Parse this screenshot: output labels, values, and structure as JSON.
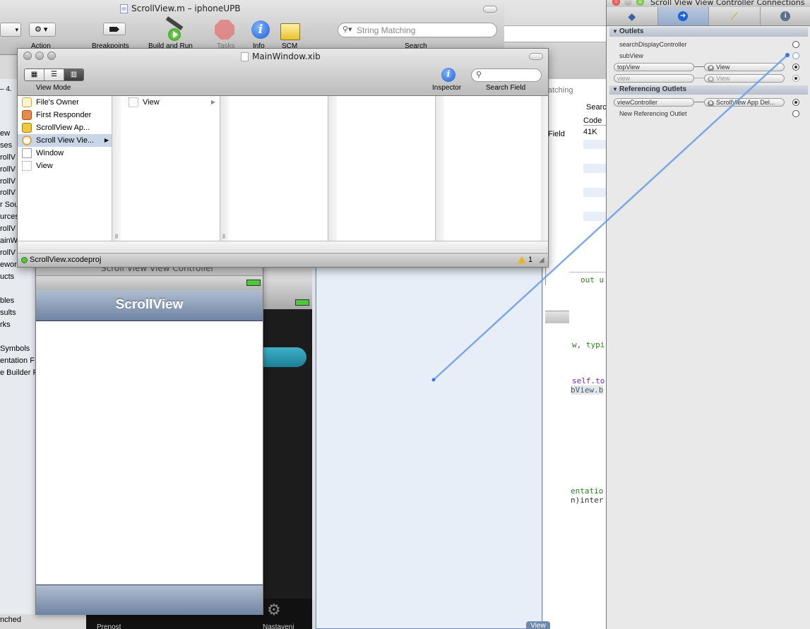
{
  "xcode_window": {
    "title": "ScrollView.m – iphoneUPB",
    "toolbar": [
      {
        "label": "Action"
      },
      {
        "label": "Breakpoints"
      },
      {
        "label": "Build and Run"
      },
      {
        "label": "Tasks"
      },
      {
        "label": "Info"
      },
      {
        "label": "SCM"
      },
      {
        "label": "Search"
      }
    ],
    "search_placeholder": "String Matching",
    "left_fragments": [
      "– 4.",
      "ew",
      "ses",
      "rollV",
      "rollV",
      "rollV",
      "rollV",
      "r Sou",
      "urces",
      "rollV",
      "ainW",
      "rollV",
      "ewor",
      "ucts",
      "bles",
      "sults",
      "rks",
      "Symbols",
      "entation F",
      "e Builder F"
    ],
    "status_fragment": "nched",
    "code_fragments": [
      "out u",
      "w, typi",
      "self.to",
      "bView.b",
      "entatio",
      "n)inter"
    ],
    "table_fragments": {
      "search_tab": "Searc",
      "column_code": "Code",
      "size_value": "41K",
      "field_label": "Field",
      "matching_label": "atching"
    }
  },
  "xib_window": {
    "title": "MainWindow.xib",
    "view_mode_label": "View Mode",
    "inspector_label": "Inspector",
    "search_field_label": "Search Field",
    "objects": [
      {
        "label": "File's Owner",
        "icon": "cube-outline-icon",
        "selected": false
      },
      {
        "label": "First Responder",
        "icon": "cube-red-icon",
        "selected": false
      },
      {
        "label": "ScrollView Ap...",
        "icon": "cube-yellow-icon",
        "selected": false
      },
      {
        "label": "Scroll View Vie...",
        "icon": "view-controller-icon",
        "selected": true
      },
      {
        "label": "Window",
        "icon": "window-icon",
        "selected": false
      },
      {
        "label": "View",
        "icon": "view-icon",
        "selected": false
      }
    ],
    "second_column_item": "View",
    "project_file": "ScrollView.xcodeproj",
    "warning_count": "1"
  },
  "sim_window": {
    "title": "Scroll View View Controller",
    "navbar_title": "ScrollView"
  },
  "tabbar_fragments": {
    "left": "Prenost",
    "right": "Nastaveni"
  },
  "view_badge": "View",
  "connections_panel": {
    "title": "Scroll View View Controller Connections",
    "tabs": [
      "attributes-icon",
      "connections-icon",
      "size-icon",
      "identity-icon"
    ],
    "outlets_header": "Outlets",
    "outlets": [
      {
        "name": "searchDisplayController",
        "connected": false,
        "target": ""
      },
      {
        "name": "subView",
        "connected": true,
        "target": "",
        "dragging": true
      },
      {
        "name": "topView",
        "connected": true,
        "target": "View",
        "capsule": true
      },
      {
        "name": "view",
        "connected": true,
        "target": "View",
        "capsule": true,
        "dim": true
      }
    ],
    "referencing_header": "Referencing Outlets",
    "referencing": [
      {
        "name": "viewController",
        "connected": true,
        "target": "ScrollView App Del...",
        "capsule": true
      },
      {
        "name": "New Referencing Outlet",
        "connected": false,
        "target": ""
      }
    ]
  },
  "colors": {
    "selection": "#c9d6e8",
    "navbar": "#6e84a3",
    "connection_line": "#6fa1e6",
    "view_bg": "#e8eef7"
  }
}
